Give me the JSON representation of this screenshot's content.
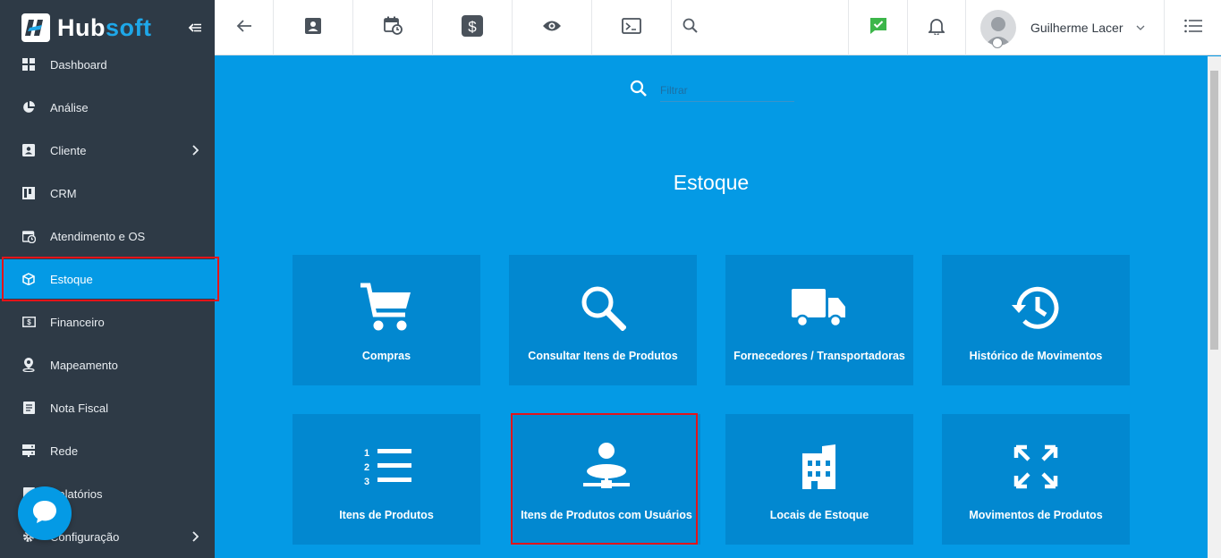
{
  "brand": {
    "name_part1": "Hub",
    "name_part2": "soft"
  },
  "colors": {
    "sidebar": "#2e3a46",
    "accent": "#049ae5",
    "tile": "#0288d0",
    "highlight": "#e3141a",
    "logo_blue": "#1ea7e8"
  },
  "sidebar": {
    "items": [
      {
        "label": "Dashboard",
        "icon": "dashboard-icon"
      },
      {
        "label": "Análise",
        "icon": "pie-chart-icon"
      },
      {
        "label": "Cliente",
        "icon": "contact-card-icon",
        "has_submenu": true
      },
      {
        "label": "CRM",
        "icon": "kanban-icon"
      },
      {
        "label": "Atendimento e OS",
        "icon": "calendar-clock-icon"
      },
      {
        "label": "Estoque",
        "icon": "box-icon",
        "active": true
      },
      {
        "label": "Financeiro",
        "icon": "money-icon"
      },
      {
        "label": "Mapeamento",
        "icon": "map-pin-icon"
      },
      {
        "label": "Nota Fiscal",
        "icon": "document-icon"
      },
      {
        "label": "Rede",
        "icon": "server-icon"
      },
      {
        "label": "Relatórios",
        "icon": "report-icon"
      },
      {
        "label": "Configuração",
        "icon": "gear-icon",
        "has_submenu": true
      }
    ]
  },
  "topbar": {
    "buttons": [
      "back-arrow-icon",
      "contact-card-icon",
      "calendar-clock-icon",
      "dollar-icon",
      "eye-icon",
      "terminal-icon",
      "search-icon",
      "check-message-icon",
      "bell-icon"
    ],
    "user": {
      "name": "Guilherme Lacer"
    }
  },
  "main": {
    "search": {
      "placeholder": "Filtrar"
    },
    "title": "Estoque",
    "tiles": [
      {
        "label": "Compras",
        "icon": "shopping-cart-icon"
      },
      {
        "label": "Consultar Itens de Produtos",
        "icon": "magnifier-icon"
      },
      {
        "label": "Fornecedores / Transportadoras",
        "icon": "truck-icon"
      },
      {
        "label": "Histórico de Movimentos",
        "icon": "history-icon"
      },
      {
        "label": "Itens de Produtos",
        "icon": "numbered-list-icon"
      },
      {
        "label": "Itens de Produtos com Usuários",
        "icon": "user-network-icon",
        "highlighted": true
      },
      {
        "label": "Locais de Estoque",
        "icon": "building-icon"
      },
      {
        "label": "Movimentos de Produtos",
        "icon": "arrows-move-icon"
      }
    ]
  }
}
